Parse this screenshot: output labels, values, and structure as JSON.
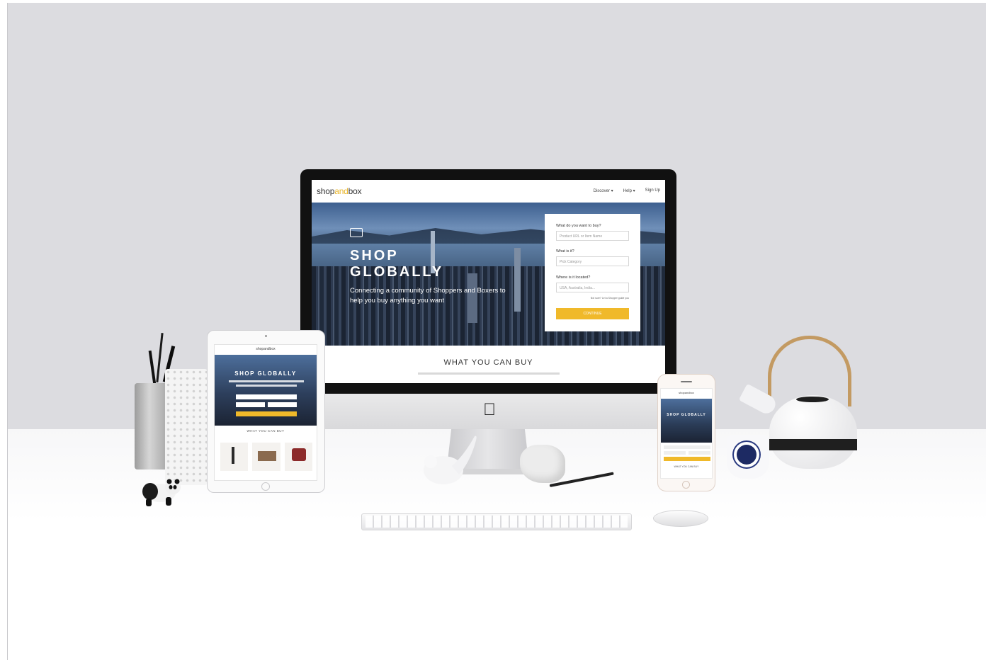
{
  "site": {
    "logo_prefix": "shop",
    "logo_accent": "and",
    "logo_suffix": "box",
    "nav": [
      "Discover ▾",
      "Help ▾",
      "Sign Up"
    ],
    "hero_title_line1": "SHOP",
    "hero_title_line2": "GLOBALLY",
    "hero_sub": "Connecting a community of Shoppers and Boxers to help you buy anything you want",
    "form": {
      "q1_label": "What do you want to buy?",
      "q1_placeholder": "Product URL or Item Name",
      "q2_label": "What is it?",
      "q2_placeholder": "Pick Category",
      "q3_label": "Where is it located?",
      "q3_placeholder": "USA, Australia, India...",
      "note": "Not sure? Let a Shopper guide you",
      "button": "CONTINUE"
    },
    "section_title": "WHAT YOU CAN BUY"
  },
  "tablet": {
    "logo": "shopandbox",
    "hero_title": "SHOP GLOBALLY",
    "section_title": "WHAT YOU CAN BUY"
  },
  "phone": {
    "logo": "shopandbox",
    "hero_title": "SHOP GLOBALLY",
    "section_title": "WHAT YOU CAN BUY"
  },
  "colors": {
    "accent": "#f0b92a",
    "wall": "#dcdce0"
  }
}
